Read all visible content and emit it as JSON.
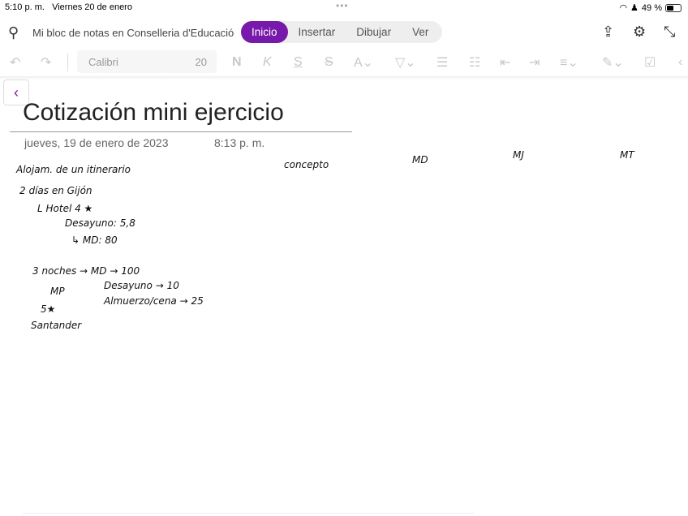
{
  "status": {
    "time": "5:10 p. m.",
    "date": "Viernes 20 de enero",
    "dots": "•••",
    "battery": "49 %",
    "battery_level": 0.49
  },
  "header": {
    "notebook": "Mi bloc de notas en Conselleria d'Educació",
    "tabs": [
      "Inicio",
      "Insertar",
      "Dibujar",
      "Ver"
    ],
    "active_tab": "Inicio",
    "accent": "#7719aa"
  },
  "toolbar": {
    "font": "Calibri",
    "size": "20",
    "bold": "N",
    "italic": "K",
    "underline": "S",
    "strike": "S"
  },
  "page": {
    "title": "Cotización mini ejercicio",
    "date": "jueves, 19 de enero de 2023",
    "time": "8:13 p. m."
  },
  "ink": {
    "headers": [
      "concepto",
      "MD",
      "MJ",
      "MT"
    ],
    "lines": [
      "Alojam. de un itinerario",
      "2 días en Gijón",
      "L Hotel 4 ★",
      "Desayuno: 5,8",
      "↳ MD: 80",
      "3 noches → MD → 100",
      "MP",
      "Desayuno → 10",
      "5★",
      "Almuerzo/cena → 25",
      "Santander"
    ]
  }
}
